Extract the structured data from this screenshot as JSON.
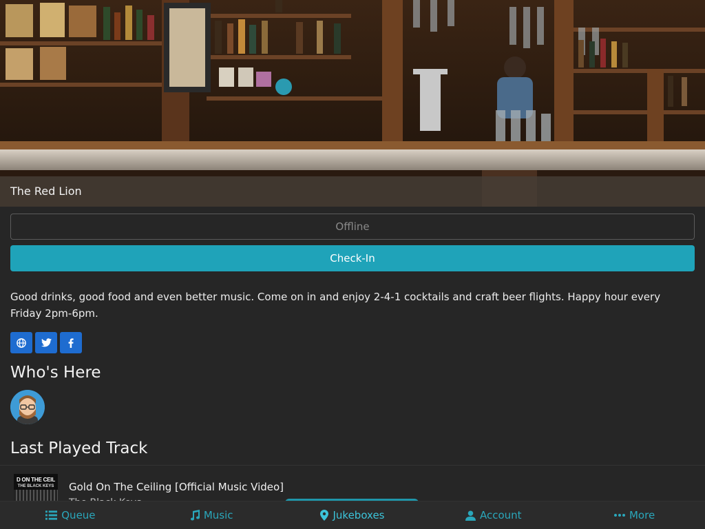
{
  "venue": {
    "name": "The Red Lion",
    "status": "Offline",
    "checkin_label": "Check-In",
    "description": "Good drinks, good food and even better music. Come on in and enjoy 2-4-1 cocktails and craft beer flights. Happy hour every Friday 2pm-6pm."
  },
  "social": [
    {
      "icon": "globe-icon"
    },
    {
      "icon": "twitter-icon"
    },
    {
      "icon": "facebook-icon"
    }
  ],
  "whos_here": {
    "heading": "Who's Here"
  },
  "last_played": {
    "heading": "Last Played Track",
    "art_line1": "D ON THE CEIL",
    "art_line2": "THE BLACK KEYS",
    "title": "Gold On The Ceiling [Official Music Video]",
    "artist": "The Black Keys"
  },
  "nav": {
    "items": [
      {
        "label": "Queue",
        "icon": "list-icon"
      },
      {
        "label": "Music",
        "icon": "music-note-icon"
      },
      {
        "label": "Jukeboxes",
        "icon": "map-pin-icon",
        "active": true
      },
      {
        "label": "Account",
        "icon": "user-icon"
      },
      {
        "label": "More",
        "icon": "ellipsis-icon"
      }
    ]
  },
  "colors": {
    "accent": "#1fa3b9",
    "nav_text": "#2aa7bb",
    "social_blue": "#1e6cd0",
    "background": "#262626"
  }
}
